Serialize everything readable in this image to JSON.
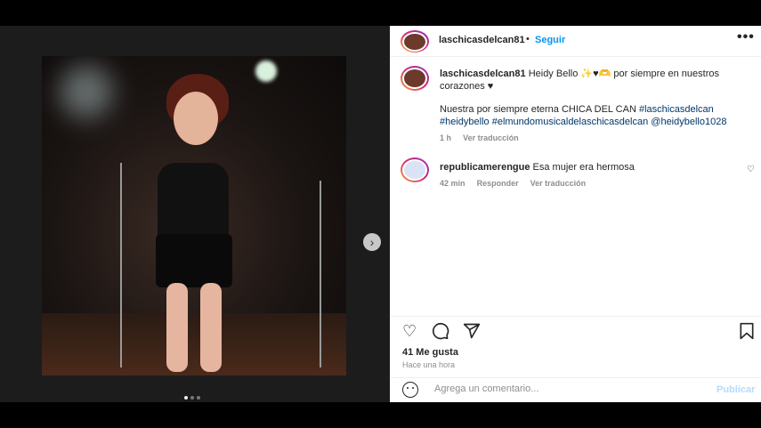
{
  "header": {
    "username": "laschicasdelcan81",
    "separator": "•",
    "follow_label": "Seguir",
    "more_label": "•••"
  },
  "post": {
    "next_arrow": "›",
    "carousel_total": 3,
    "carousel_active": 1
  },
  "caption": {
    "username": "laschicasdelcan81",
    "text_line1": "Heidy Bello ✨♥🫶 por siempre en nuestros corazones ♥",
    "text_line2": "Nuestra por siempre eterna CHICA DEL CAN",
    "hashtags": [
      "#laschicasdelcan",
      "#heidybello",
      "#elmundomusicaldelaschicasdelcan",
      "@heidybello1028"
    ],
    "time": "1 h",
    "translate": "Ver traducción"
  },
  "comment": {
    "username": "republicamerengue",
    "text": "Esa mujer era hermosa",
    "time": "42 min",
    "reply": "Responder",
    "translate": "Ver traducción"
  },
  "stats": {
    "likes": "41 Me gusta",
    "posted_ago": "Hace una hora"
  },
  "composer": {
    "placeholder": "Agrega un comentario...",
    "publish_label": "Publicar"
  },
  "icons": {
    "like": "heart-icon",
    "comment": "comment-icon",
    "share": "send-icon",
    "save": "bookmark-icon",
    "emoji": "emoji-icon"
  },
  "colors": {
    "link": "#0095f6",
    "hashtag": "#00376b",
    "muted": "#8e8e8e",
    "publish_disabled": "#b3dbff"
  }
}
